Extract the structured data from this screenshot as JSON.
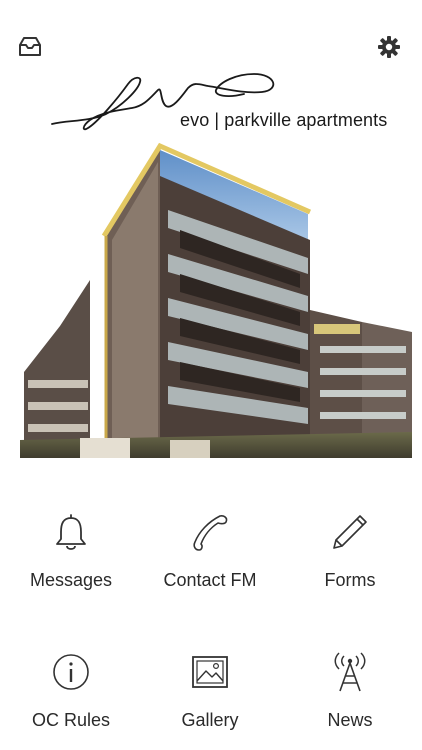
{
  "header": {
    "left_icon": "inbox-icon",
    "right_icon": "gear-icon"
  },
  "brand": {
    "logo_text": "evo | parkville apartments"
  },
  "hero": {
    "description_icon": "apartment-building-image"
  },
  "menu": [
    {
      "label": "Messages",
      "icon": "bell-icon"
    },
    {
      "label": "Contact FM",
      "icon": "phone-icon"
    },
    {
      "label": "Forms",
      "icon": "pencil-icon"
    },
    {
      "label": "OC Rules",
      "icon": "info-icon"
    },
    {
      "label": "Gallery",
      "icon": "image-icon"
    },
    {
      "label": "News",
      "icon": "broadcast-tower-icon"
    }
  ],
  "colors": {
    "icon": "#333333",
    "text": "#2a2a2a",
    "background": "#ffffff"
  }
}
